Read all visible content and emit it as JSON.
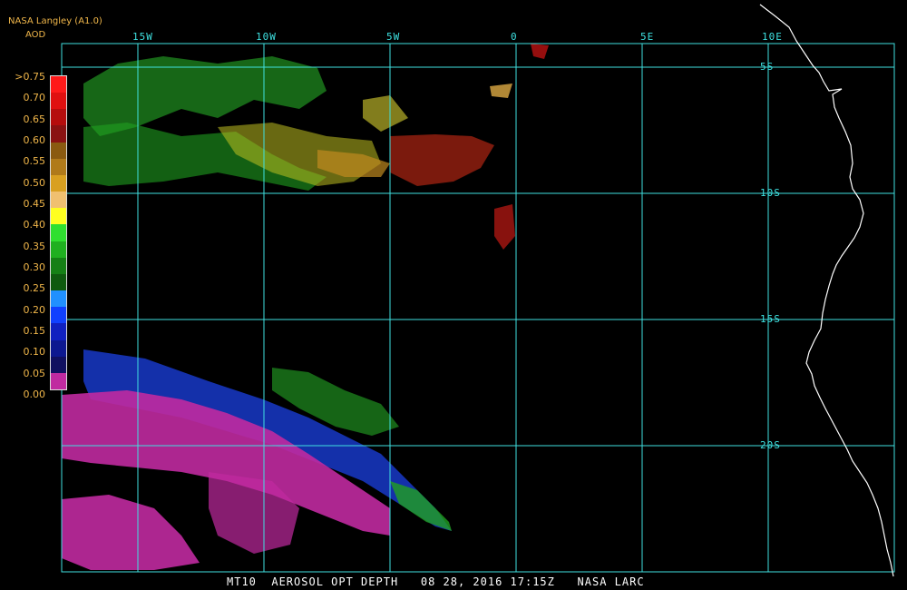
{
  "header": {
    "source": "NASA Langley (A1.0)",
    "product": "AOD"
  },
  "colorbar": {
    "ticks": [
      ">0.75",
      "0.70",
      "0.65",
      "0.60",
      "0.55",
      "0.50",
      "0.45",
      "0.40",
      "0.35",
      "0.30",
      "0.25",
      "0.20",
      "0.15",
      "0.10",
      "0.05",
      "0.00"
    ],
    "colors": [
      "#ff1a1a",
      "#e01010",
      "#b50d0d",
      "#8a1212",
      "#8a5a10",
      "#b07a1a",
      "#d9a020",
      "#f0c070",
      "#ffff20",
      "#30e030",
      "#20b020",
      "#158015",
      "#0f5a0f",
      "#2090ff",
      "#1040ff",
      "#1020c0",
      "#0d1890",
      "#101060",
      "#c02aa0"
    ]
  },
  "lon_labels": [
    "15W",
    "10W",
    "5W",
    "0",
    "5E",
    "10E"
  ],
  "lat_labels": [
    "5S",
    "10S",
    "15S",
    "20S"
  ],
  "footer": "MT10  AEROSOL OPT DEPTH   08 28, 2016 17:15Z   NASA LARC",
  "colors": {
    "grid": "#40e0e0",
    "coast": "#ffffff",
    "label": "#f0b64a"
  }
}
